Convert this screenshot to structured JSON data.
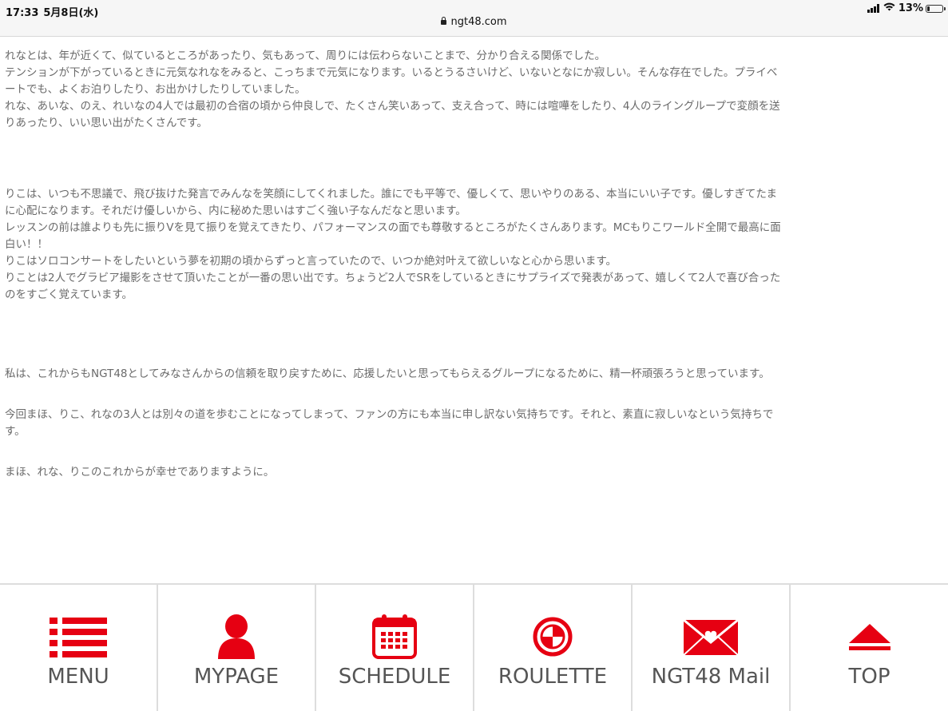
{
  "status_bar": {
    "time": "17:33",
    "date": "5月8日(水)",
    "url": "ngt48.com",
    "battery": "13%"
  },
  "article": {
    "lines": [
      "れなとは、年が近くて、似ているところがあったり、気もあって、周りには伝わらないことまで、分かり合える関係でした。",
      "テンションが下がっているときに元気なれなをみると、こっちまで元気になります。いるとうるさいけど、いないとなにか寂しい。そんな存在でした。プライベ",
      "ートでも、よくお泊りしたり、お出かけしたりしていました。",
      "れな、あいな、のえ、れいなの4人では最初の合宿の頃から仲良しで、たくさん笑いあって、支え合って、時には喧嘩をしたり、4人のライングループで変顔を送",
      "りあったり、いい思い出がたくさんです。",
      "りこは、いつも不思議で、飛び抜けた発言でみんなを笑顔にしてくれました。誰にでも平等で、優しくて、思いやりのある、本当にいい子です。優しすぎてたま",
      "に心配になります。それだけ優しいから、内に秘めた思いはすごく強い子なんだなと思います。",
      "レッスンの前は誰よりも先に振りVを見て振りを覚えてきたり、パフォーマンスの面でも尊敬するところがたくさんあります。MCもりこワールド全開で最高に面",
      "白い！！",
      "りこはソロコンサートをしたいという夢を初期の頃からずっと言っていたので、いつか絶対叶えて欲しいなと心から思います。",
      "りことは2人でグラビア撮影をさせて頂いたことが一番の思い出です。ちょうど2人でSRをしているときにサプライズで発表があって、嬉しくて2人で喜び合った",
      "のをすごく覚えています。",
      "私は、これからもNGT48としてみなさんからの信頼を取り戻すために、応援したいと思ってもらえるグループになるために、精一杯頑張ろうと思っています。",
      "今回まほ、りこ、れなの3人とは別々の道を歩むことになってしまって、ファンの方にも本当に申し訳ない気持ちです。それと、素直に寂しいなという気持ちで",
      "す。",
      "まほ、れな、りこのこれからが幸せでありますように。"
    ]
  },
  "nav": {
    "items": [
      {
        "label": "MENU",
        "icon": "menu-list-icon"
      },
      {
        "label": "MYPAGE",
        "icon": "person-icon"
      },
      {
        "label": "SCHEDULE",
        "icon": "calendar-icon"
      },
      {
        "label": "ROULETTE",
        "icon": "roulette-icon"
      },
      {
        "label": "NGT48 Mail",
        "icon": "envelope-heart-icon"
      },
      {
        "label": "TOP",
        "icon": "triangle-up-icon"
      }
    ]
  },
  "colors": {
    "accent": "#e60012",
    "text": "#6a6a6a",
    "nav_label": "#555555"
  }
}
